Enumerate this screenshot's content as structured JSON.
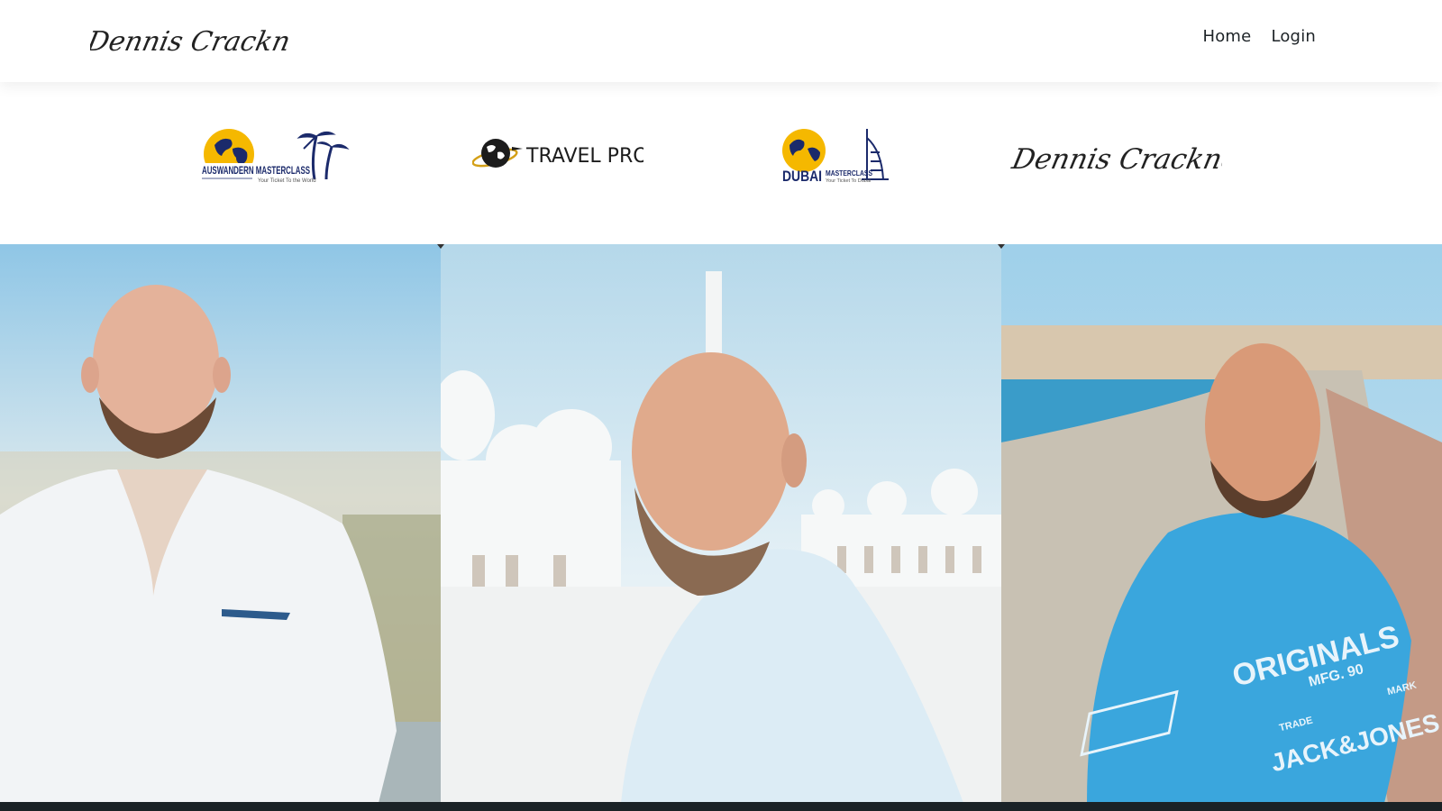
{
  "header": {
    "brand_signature": "Dennis Cracknell",
    "nav": [
      {
        "label": "Home"
      },
      {
        "label": "Login"
      }
    ]
  },
  "partners": {
    "auswandern": {
      "title": "AUSWANDERN MASTERCLASS",
      "tagline": "Your Ticket To the World"
    },
    "travelpro": {
      "title": "TRAVEL PRO"
    },
    "dubai": {
      "title_big": "DUBAI",
      "title_small": "MASTERCLASS",
      "tagline": "Your Ticket To Dubai"
    },
    "signature": {
      "text": "Dennis Cracknell"
    }
  },
  "photos": {
    "tshirt": {
      "line1": "ORIGINALS",
      "badge": "MFG. 90",
      "left": "TRADE",
      "right": "MARK",
      "brand": "JACK&JONES"
    }
  },
  "colors": {
    "brand_navy": "#1b2a6b",
    "globe_yellow": "#f5b800",
    "footer": "#1a2226",
    "shirt_blue": "#3aa6dd"
  }
}
